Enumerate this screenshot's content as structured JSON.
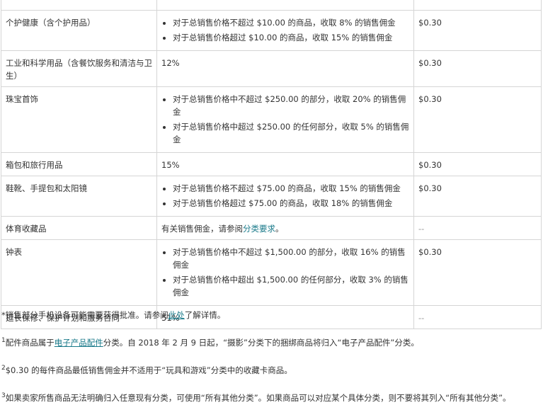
{
  "rows": [
    {
      "category": "",
      "fee": "",
      "min": ""
    },
    {
      "category": "个护健康（含个护用品）",
      "bullets": [
        "对于总销售价格不超过 $10.00 的商品，收取 8% 的销售佣金",
        "对于总销售价格超过 $10.00 的商品，收取 15% 的销售佣金"
      ],
      "min": "$0.30"
    },
    {
      "category": "工业和科学用品（含餐饮服务和清洁与卫生）",
      "fee": "12%",
      "min": "$0.30"
    },
    {
      "category": "珠宝首饰",
      "bullets": [
        "对于总销售价格中不超过 $250.00 的部分，收取 20% 的销售佣金",
        "对于总销售价格中超过 $250.00 的任何部分，收取 5% 的销售佣金"
      ],
      "min": "$0.30"
    },
    {
      "category": "箱包和旅行用品",
      "fee": "15%",
      "min": "$0.30"
    },
    {
      "category": "鞋靴、手提包和太阳镜",
      "bullets": [
        "对于总销售价格不超过 $75.00 的商品，收取 15% 的销售佣金",
        "对于总销售价格超过 $75.00 的商品，收取 18% 的销售佣金"
      ],
      "min": "$0.30"
    },
    {
      "category": "体育收藏品",
      "fee_prefix": "有关销售佣金，请参阅",
      "fee_link": "分类要求",
      "fee_suffix": "。",
      "min": "--"
    },
    {
      "category": "钟表",
      "bullets": [
        "对于总销售价格中不超过 $1,500.00 的部分，收取 16% 的销售佣金",
        "对于总销售价格中超出 $1,500.00 的任何部分，收取 3% 的销售佣金"
      ],
      "min": "$0.30"
    },
    {
      "category": "延长保修、保护计划和服务合同",
      "fee": "51%",
      "min": "--"
    }
  ],
  "notes": {
    "n0_prefix": "*销售部分手机设备可能需要获得批准。请参阅",
    "n0_link": "此处",
    "n0_suffix": "了解详情。",
    "n1_sup": "1",
    "n1_prefix": "配件商品属于",
    "n1_link": "电子产品配件",
    "n1_suffix": "分类。自 2018 年 2 月 9 日起，“摄影”分类下的捆绑商品将归入“电子产品配件”分类。",
    "n2_sup": "2",
    "n2_text": "$0.30 的每件商品最低销售佣金并不适用于“玩具和游戏”分类中的收藏卡商品。",
    "n3_sup": "3",
    "n3_text": "如果卖家所售商品无法明确归入任意现有分类，可使用“所有其他分类”。如果商品可以对应某个具体分类，则不要将其列入“所有其他分类”。"
  }
}
